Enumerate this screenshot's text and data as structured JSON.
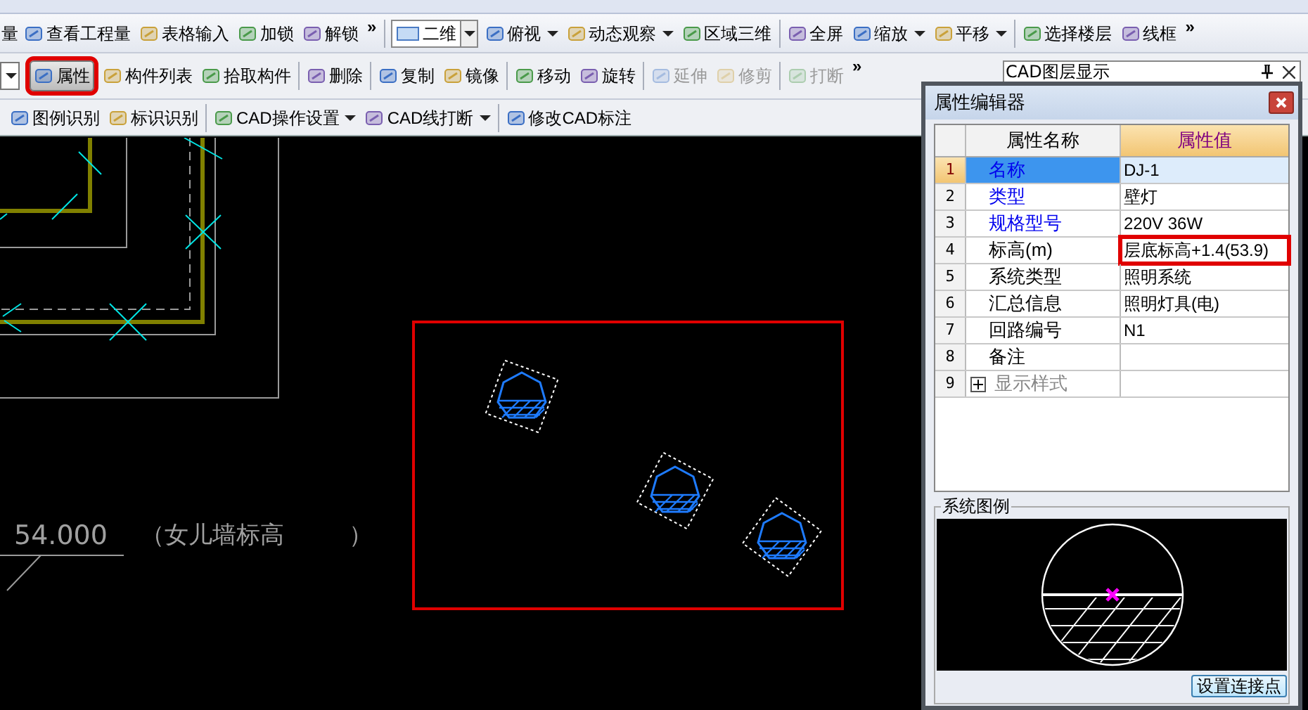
{
  "toolbars": [
    {
      "groups": [
        [
          {
            "kind": "text",
            "label": "量"
          },
          {
            "kind": "button",
            "label": "查看工程量"
          },
          {
            "kind": "button",
            "label": "表格输入"
          },
          {
            "kind": "button",
            "label": "加锁"
          },
          {
            "kind": "button",
            "label": "解锁"
          },
          {
            "kind": "overflow",
            "label": "»"
          }
        ],
        [
          {
            "kind": "combo",
            "label": "二维"
          },
          {
            "kind": "menu",
            "label": "俯视"
          },
          {
            "kind": "menu",
            "label": "动态观察"
          },
          {
            "kind": "button",
            "label": "区域三维"
          }
        ],
        [
          {
            "kind": "button",
            "label": "全屏"
          },
          {
            "kind": "menu",
            "label": "缩放"
          },
          {
            "kind": "menu",
            "label": "平移"
          }
        ],
        [
          {
            "kind": "button",
            "label": "选择楼层"
          },
          {
            "kind": "button",
            "label": "线框"
          },
          {
            "kind": "overflow",
            "label": "»"
          }
        ]
      ]
    },
    {
      "groups": [
        [
          {
            "kind": "button",
            "label": "属性",
            "selected": true,
            "disabled": false,
            "highlighted": true
          },
          {
            "kind": "button",
            "label": "构件列表",
            "selected": false,
            "disabled": false,
            "highlighted": false
          },
          {
            "kind": "button",
            "label": "拾取构件",
            "selected": false,
            "disabled": false,
            "highlighted": false
          }
        ],
        [
          {
            "kind": "button",
            "label": "删除",
            "selected": false,
            "disabled": false,
            "highlighted": false
          }
        ],
        [
          {
            "kind": "button",
            "label": "复制",
            "selected": false,
            "disabled": false,
            "highlighted": false
          },
          {
            "kind": "button",
            "label": "镜像",
            "selected": false,
            "disabled": false,
            "highlighted": false
          }
        ],
        [
          {
            "kind": "button",
            "label": "移动",
            "selected": false,
            "disabled": false,
            "highlighted": false
          },
          {
            "kind": "button",
            "label": "旋转",
            "selected": false,
            "disabled": false,
            "highlighted": false
          }
        ],
        [
          {
            "kind": "button",
            "label": "延伸",
            "selected": false,
            "disabled": true,
            "highlighted": false
          },
          {
            "kind": "button",
            "label": "修剪",
            "selected": false,
            "disabled": true,
            "highlighted": false
          }
        ],
        [
          {
            "kind": "button",
            "label": "打断",
            "selected": false,
            "disabled": true,
            "highlighted": false
          },
          {
            "kind": "overflow",
            "label": "»"
          }
        ]
      ]
    },
    {
      "groups": [
        [
          {
            "kind": "button",
            "label": "图例识别"
          },
          {
            "kind": "button",
            "label": "标识识别"
          }
        ],
        [
          {
            "kind": "menu",
            "label": "CAD操作设置"
          },
          {
            "kind": "menu",
            "label": "CAD线打断"
          }
        ],
        [
          {
            "kind": "button",
            "label": "修改CAD标注"
          }
        ]
      ]
    }
  ],
  "layer_panel": {
    "title": "CAD图层显示"
  },
  "canvas": {
    "labels": [
      "54.000",
      "（女儿墙标高",
      "）"
    ]
  },
  "property_editor": {
    "title": "属性编辑器",
    "columns": [
      "属性名称",
      "属性值"
    ],
    "rows": [
      {
        "no": "1",
        "kind": "field",
        "name": "名称",
        "value": "DJ-1",
        "required": true,
        "selected": true,
        "highlighted": false
      },
      {
        "no": "2",
        "kind": "field",
        "name": "类型",
        "value": "壁灯",
        "required": true,
        "selected": false,
        "highlighted": false
      },
      {
        "no": "3",
        "kind": "field",
        "name": "规格型号",
        "value": "220V 36W",
        "required": true,
        "selected": false,
        "highlighted": false
      },
      {
        "no": "4",
        "kind": "field",
        "name": "标高(m)",
        "value": "层底标高+1.4(53.9)",
        "required": false,
        "selected": false,
        "highlighted": true
      },
      {
        "no": "5",
        "kind": "field",
        "name": "系统类型",
        "value": "照明系统",
        "required": false,
        "selected": false,
        "highlighted": false
      },
      {
        "no": "6",
        "kind": "field",
        "name": "汇总信息",
        "value": "照明灯具(电)",
        "required": false,
        "selected": false,
        "highlighted": false
      },
      {
        "no": "7",
        "kind": "field",
        "name": "回路编号",
        "value": "N1",
        "required": false,
        "selected": false,
        "highlighted": false
      },
      {
        "no": "8",
        "kind": "field",
        "name": "备注",
        "value": "",
        "required": false,
        "selected": false
      },
      {
        "no": "9",
        "kind": "group",
        "name": "显示样式",
        "expanded": false,
        "selected": false
      }
    ],
    "legend": {
      "title": "系统图例",
      "button": "设置连接点"
    }
  }
}
